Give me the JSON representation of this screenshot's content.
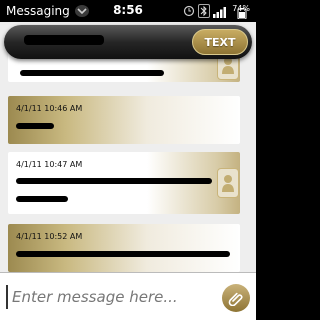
{
  "status_bar": {
    "app_title": "Messaging",
    "clock": "8:56",
    "battery_text": "74%"
  },
  "header": {
    "contact_name": "",
    "text_button_label": "TEXT"
  },
  "messages": [
    {
      "timestamp": "",
      "direction": "incoming",
      "has_avatar": true
    },
    {
      "timestamp": "4/1/11 10:46 AM",
      "direction": "outgoing",
      "has_avatar": false
    },
    {
      "timestamp": "4/1/11 10:47 AM",
      "direction": "incoming",
      "has_avatar": true
    },
    {
      "timestamp": "4/1/11 10:52 AM",
      "direction": "outgoing",
      "has_avatar": false
    }
  ],
  "compose": {
    "placeholder": "Enter message here..."
  },
  "colors": {
    "accent_gold": "#a88d4c",
    "status_bar_bg": "#000000",
    "header_bg": "#262626"
  },
  "icons": {
    "app_menu": "chevron-down-icon",
    "status": [
      "clock-icon",
      "bluetooth-icon",
      "signal-bars-icon",
      "battery-icon"
    ],
    "avatar": "person-silhouette-icon",
    "attach": "paperclip-icon"
  }
}
